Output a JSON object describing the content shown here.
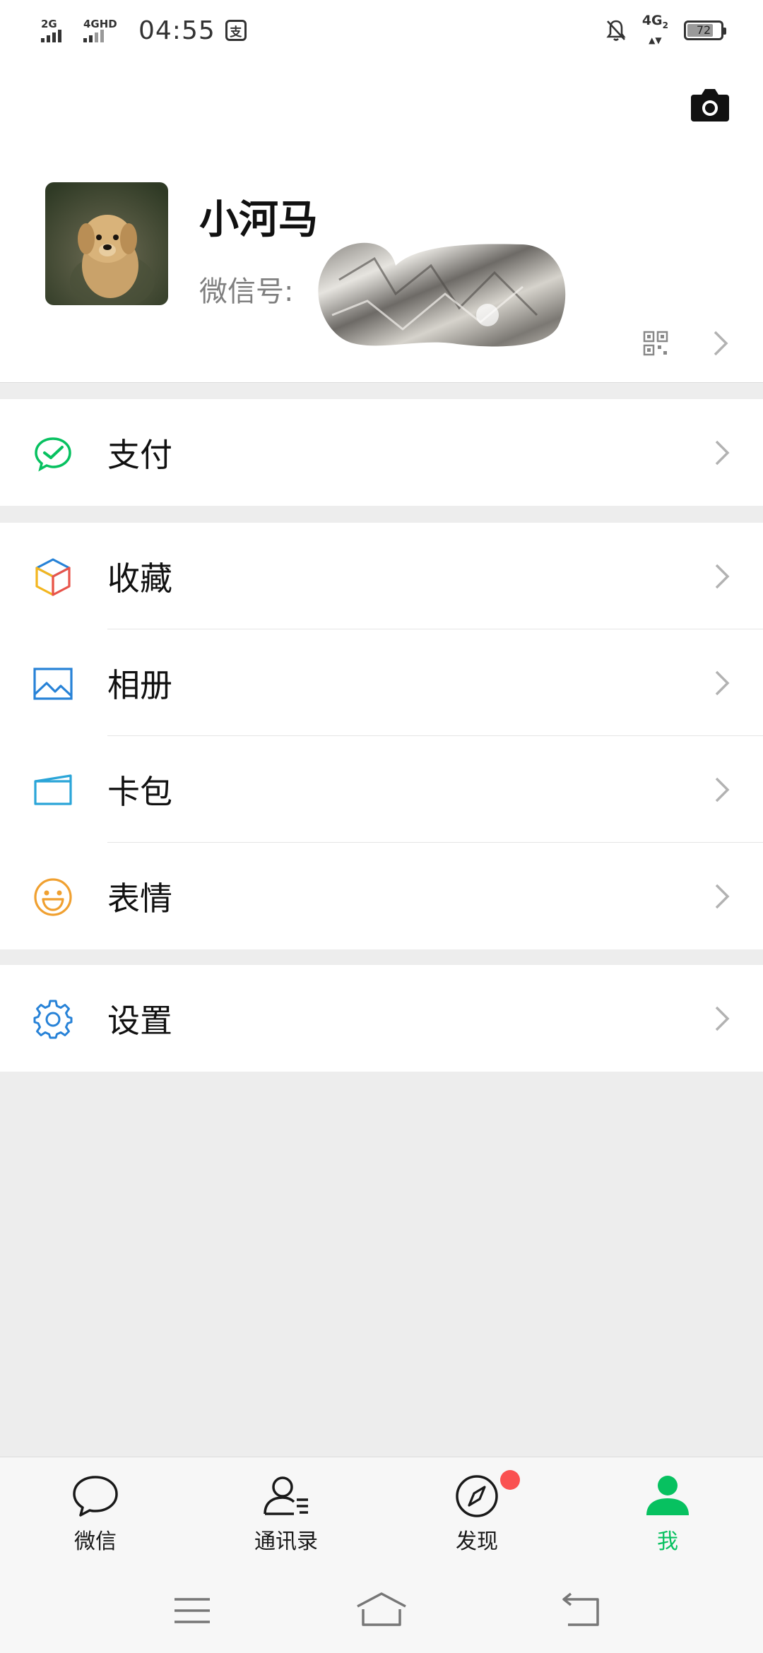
{
  "status_bar": {
    "signal1_label": "2G",
    "signal2_label": "4GHD",
    "time": "04:55",
    "app_badge": "支",
    "network": "4G",
    "network_sub": "2",
    "battery": "72"
  },
  "profile": {
    "nickname": "小河马",
    "wechat_id_label": "微信号:",
    "icons": {
      "camera": "camera-icon",
      "qr": "qr-code-icon",
      "chevron": "chevron-right-icon"
    }
  },
  "menu": {
    "pay": {
      "label": "支付",
      "icon": "wechat-pay-icon",
      "color": "#07c160"
    },
    "favorites": {
      "label": "收藏",
      "icon": "favorites-cube-icon"
    },
    "album": {
      "label": "相册",
      "icon": "album-icon",
      "color": "#2782d7"
    },
    "cards": {
      "label": "卡包",
      "icon": "card-wallet-icon",
      "color": "#2aa5d8"
    },
    "stickers": {
      "label": "表情",
      "icon": "sticker-smile-icon",
      "color": "#f0a030"
    },
    "settings": {
      "label": "设置",
      "icon": "settings-gear-icon",
      "color": "#2782d7"
    }
  },
  "tabs": [
    {
      "label": "微信",
      "icon": "chat-bubble-icon",
      "active": false
    },
    {
      "label": "通讯录",
      "icon": "contacts-icon",
      "active": false
    },
    {
      "label": "发现",
      "icon": "compass-icon",
      "active": false,
      "badge": true
    },
    {
      "label": "我",
      "icon": "me-person-icon",
      "active": true
    }
  ],
  "colors": {
    "accent": "#07c160",
    "badge": "#fa5151",
    "background": "#ededed"
  },
  "system_nav": [
    "menu-icon",
    "home-icon",
    "back-icon"
  ]
}
